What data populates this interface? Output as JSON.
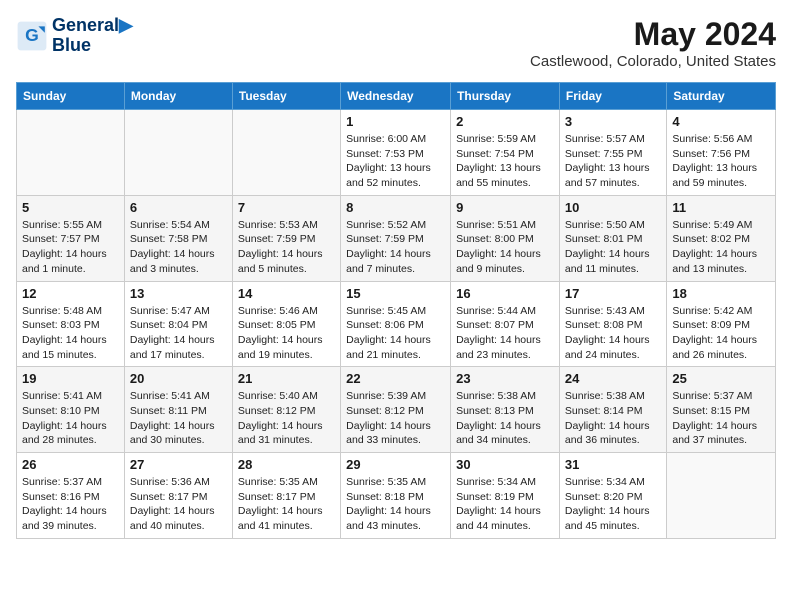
{
  "header": {
    "logo_line1": "General",
    "logo_line2": "Blue",
    "month": "May 2024",
    "location": "Castlewood, Colorado, United States"
  },
  "days_of_week": [
    "Sunday",
    "Monday",
    "Tuesday",
    "Wednesday",
    "Thursday",
    "Friday",
    "Saturday"
  ],
  "weeks": [
    [
      {
        "day": "",
        "info": ""
      },
      {
        "day": "",
        "info": ""
      },
      {
        "day": "",
        "info": ""
      },
      {
        "day": "1",
        "info": "Sunrise: 6:00 AM\nSunset: 7:53 PM\nDaylight: 13 hours\nand 52 minutes."
      },
      {
        "day": "2",
        "info": "Sunrise: 5:59 AM\nSunset: 7:54 PM\nDaylight: 13 hours\nand 55 minutes."
      },
      {
        "day": "3",
        "info": "Sunrise: 5:57 AM\nSunset: 7:55 PM\nDaylight: 13 hours\nand 57 minutes."
      },
      {
        "day": "4",
        "info": "Sunrise: 5:56 AM\nSunset: 7:56 PM\nDaylight: 13 hours\nand 59 minutes."
      }
    ],
    [
      {
        "day": "5",
        "info": "Sunrise: 5:55 AM\nSunset: 7:57 PM\nDaylight: 14 hours\nand 1 minute."
      },
      {
        "day": "6",
        "info": "Sunrise: 5:54 AM\nSunset: 7:58 PM\nDaylight: 14 hours\nand 3 minutes."
      },
      {
        "day": "7",
        "info": "Sunrise: 5:53 AM\nSunset: 7:59 PM\nDaylight: 14 hours\nand 5 minutes."
      },
      {
        "day": "8",
        "info": "Sunrise: 5:52 AM\nSunset: 7:59 PM\nDaylight: 14 hours\nand 7 minutes."
      },
      {
        "day": "9",
        "info": "Sunrise: 5:51 AM\nSunset: 8:00 PM\nDaylight: 14 hours\nand 9 minutes."
      },
      {
        "day": "10",
        "info": "Sunrise: 5:50 AM\nSunset: 8:01 PM\nDaylight: 14 hours\nand 11 minutes."
      },
      {
        "day": "11",
        "info": "Sunrise: 5:49 AM\nSunset: 8:02 PM\nDaylight: 14 hours\nand 13 minutes."
      }
    ],
    [
      {
        "day": "12",
        "info": "Sunrise: 5:48 AM\nSunset: 8:03 PM\nDaylight: 14 hours\nand 15 minutes."
      },
      {
        "day": "13",
        "info": "Sunrise: 5:47 AM\nSunset: 8:04 PM\nDaylight: 14 hours\nand 17 minutes."
      },
      {
        "day": "14",
        "info": "Sunrise: 5:46 AM\nSunset: 8:05 PM\nDaylight: 14 hours\nand 19 minutes."
      },
      {
        "day": "15",
        "info": "Sunrise: 5:45 AM\nSunset: 8:06 PM\nDaylight: 14 hours\nand 21 minutes."
      },
      {
        "day": "16",
        "info": "Sunrise: 5:44 AM\nSunset: 8:07 PM\nDaylight: 14 hours\nand 23 minutes."
      },
      {
        "day": "17",
        "info": "Sunrise: 5:43 AM\nSunset: 8:08 PM\nDaylight: 14 hours\nand 24 minutes."
      },
      {
        "day": "18",
        "info": "Sunrise: 5:42 AM\nSunset: 8:09 PM\nDaylight: 14 hours\nand 26 minutes."
      }
    ],
    [
      {
        "day": "19",
        "info": "Sunrise: 5:41 AM\nSunset: 8:10 PM\nDaylight: 14 hours\nand 28 minutes."
      },
      {
        "day": "20",
        "info": "Sunrise: 5:41 AM\nSunset: 8:11 PM\nDaylight: 14 hours\nand 30 minutes."
      },
      {
        "day": "21",
        "info": "Sunrise: 5:40 AM\nSunset: 8:12 PM\nDaylight: 14 hours\nand 31 minutes."
      },
      {
        "day": "22",
        "info": "Sunrise: 5:39 AM\nSunset: 8:12 PM\nDaylight: 14 hours\nand 33 minutes."
      },
      {
        "day": "23",
        "info": "Sunrise: 5:38 AM\nSunset: 8:13 PM\nDaylight: 14 hours\nand 34 minutes."
      },
      {
        "day": "24",
        "info": "Sunrise: 5:38 AM\nSunset: 8:14 PM\nDaylight: 14 hours\nand 36 minutes."
      },
      {
        "day": "25",
        "info": "Sunrise: 5:37 AM\nSunset: 8:15 PM\nDaylight: 14 hours\nand 37 minutes."
      }
    ],
    [
      {
        "day": "26",
        "info": "Sunrise: 5:37 AM\nSunset: 8:16 PM\nDaylight: 14 hours\nand 39 minutes."
      },
      {
        "day": "27",
        "info": "Sunrise: 5:36 AM\nSunset: 8:17 PM\nDaylight: 14 hours\nand 40 minutes."
      },
      {
        "day": "28",
        "info": "Sunrise: 5:35 AM\nSunset: 8:17 PM\nDaylight: 14 hours\nand 41 minutes."
      },
      {
        "day": "29",
        "info": "Sunrise: 5:35 AM\nSunset: 8:18 PM\nDaylight: 14 hours\nand 43 minutes."
      },
      {
        "day": "30",
        "info": "Sunrise: 5:34 AM\nSunset: 8:19 PM\nDaylight: 14 hours\nand 44 minutes."
      },
      {
        "day": "31",
        "info": "Sunrise: 5:34 AM\nSunset: 8:20 PM\nDaylight: 14 hours\nand 45 minutes."
      },
      {
        "day": "",
        "info": ""
      }
    ]
  ]
}
